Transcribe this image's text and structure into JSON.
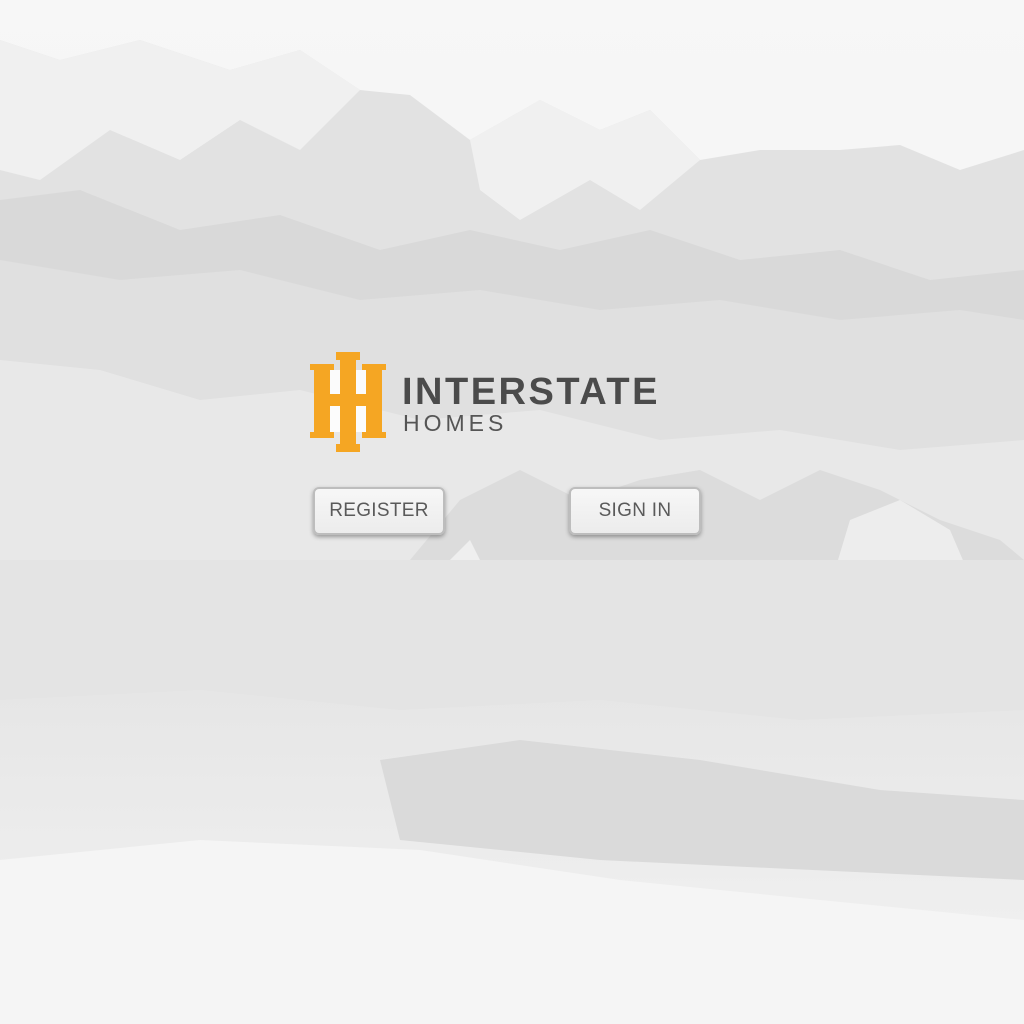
{
  "brand": {
    "wordmark": "INTERSTATE",
    "subline": "HOMES",
    "monogram_icon": "h-monogram-icon",
    "accent_color": "#f5a623",
    "text_color": "#4b4b4b"
  },
  "actions": {
    "register_label": "REGISTER",
    "signin_label": "SIGN IN"
  },
  "background": {
    "description_icon": "mountain-landscape-background"
  }
}
